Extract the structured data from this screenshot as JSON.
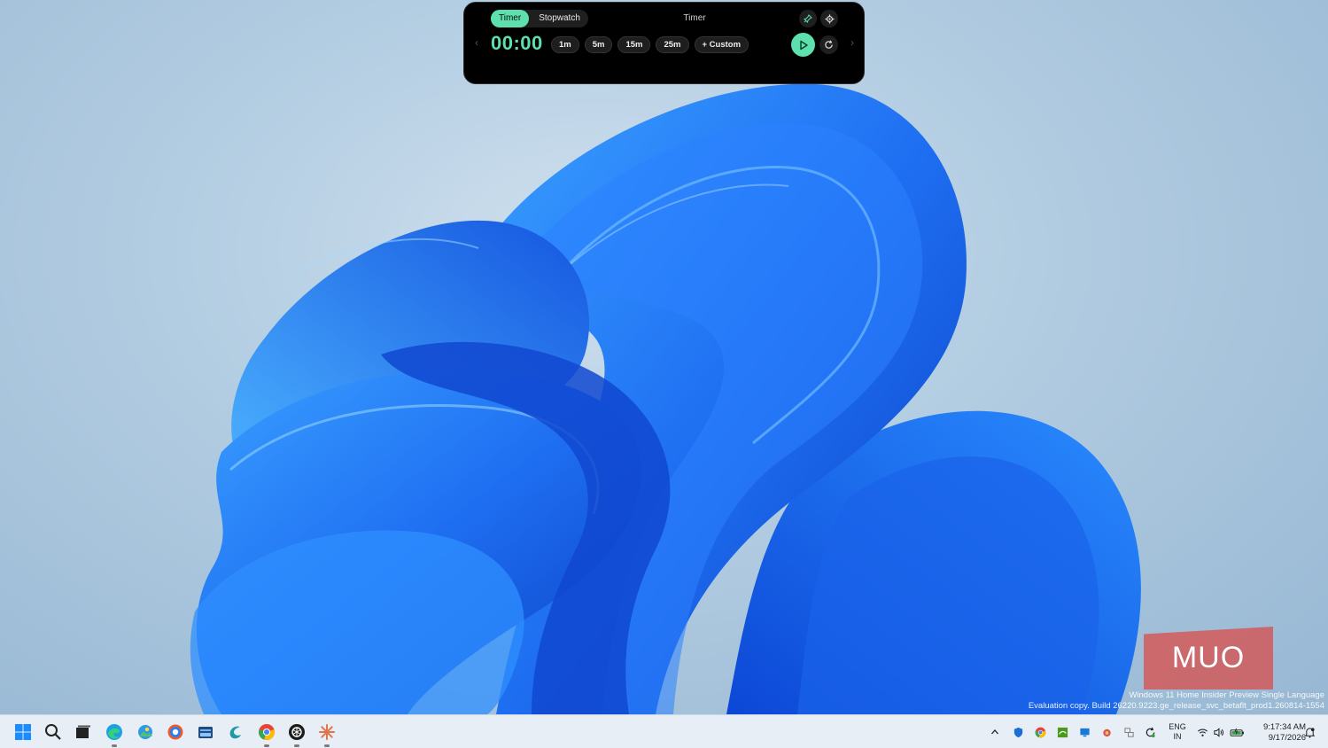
{
  "widget": {
    "tabs": [
      {
        "label": "Timer",
        "active": true
      },
      {
        "label": "Stopwatch",
        "active": false
      }
    ],
    "title": "Timer",
    "time": "00:00",
    "presets": [
      "1m",
      "5m",
      "15m",
      "25m",
      "+ Custom"
    ],
    "accent_color": "#5ee0ad",
    "icons": {
      "pin": "pin-icon",
      "settings": "gear-icon",
      "play": "play-icon",
      "reset": "reset-icon",
      "prev": "chevron-left-icon",
      "next": "chevron-right-icon"
    }
  },
  "watermark": {
    "logo": "MUO",
    "eval_line1": "Windows 11 Home Insider Preview Single Language",
    "eval_line2": "Evaluation copy. Build 26220.9223.ge_release_svc_betaflt_prod1.260814-1554"
  },
  "taskbar": {
    "apps": [
      "start-icon",
      "search-icon",
      "task-view-icon",
      "edge-icon",
      "photos-icon",
      "copilot-icon",
      "file-explorer-icon",
      "app-icon",
      "chrome-icon",
      "chatgpt-icon",
      "claude-icon"
    ],
    "tray": {
      "lang_line1": "ENG",
      "lang_line2": "IN",
      "time": "9:17:34 AM",
      "date": "9/17/2026"
    }
  }
}
